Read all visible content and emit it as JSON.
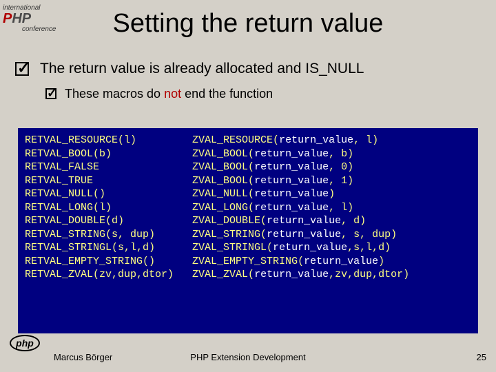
{
  "title": "Setting the return value",
  "bullet": "The return value is already allocated and IS_NULL",
  "sub_pre": "These macros do ",
  "sub_not": "not",
  "sub_post": " end the function",
  "code_rows": [
    [
      "RETVAL_RESOURCE(l)",
      "ZVAL_RESOURCE(",
      "return_value",
      ", l)"
    ],
    [
      "RETVAL_BOOL(b)",
      "ZVAL_BOOL(",
      "return_value",
      ", b)"
    ],
    [
      "RETVAL_FALSE",
      "ZVAL_BOOL(",
      "return_value",
      ", 0)"
    ],
    [
      "RETVAL_TRUE",
      "ZVAL_BOOL(",
      "return_value",
      ", 1)"
    ],
    [
      "RETVAL_NULL()",
      "ZVAL_NULL(",
      "return_value",
      ")"
    ],
    [
      "RETVAL_LONG(l)",
      "ZVAL_LONG(",
      "return_value",
      ", l)"
    ],
    [
      "RETVAL_DOUBLE(d)",
      "ZVAL_DOUBLE(",
      "return_value",
      ", d)"
    ],
    [
      "RETVAL_STRING(s, dup)",
      "ZVAL_STRING(",
      "return_value",
      ", s, dup)"
    ],
    [
      "RETVAL_STRINGL(s,l,d)",
      "ZVAL_STRINGL(",
      "return_value",
      ",s,l,d)"
    ],
    [
      "RETVAL_EMPTY_STRING()",
      "ZVAL_EMPTY_STRING(",
      "return_value",
      ")"
    ],
    [
      "RETVAL_ZVAL(zv,dup,dtor)",
      "ZVAL_ZVAL(",
      "return_value",
      ",zv,dup,dtor)"
    ]
  ],
  "footer": {
    "author": "Marcus Börger",
    "title": "PHP Extension Development",
    "page": "25"
  }
}
